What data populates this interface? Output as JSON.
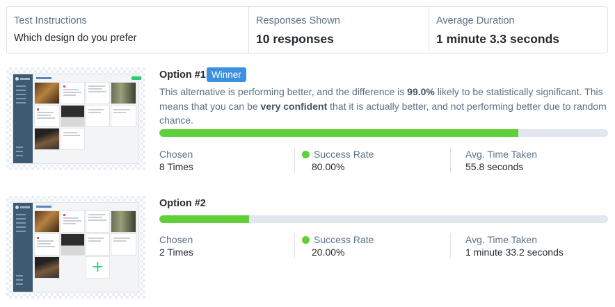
{
  "summary": {
    "test_instructions_label": "Test Instructions",
    "test_instructions_value": "Which design do you prefer",
    "responses_label": "Responses Shown",
    "responses_value": "10 responses",
    "duration_label": "Average Duration",
    "duration_value": "1 minute 3.3 seconds"
  },
  "options": [
    {
      "title": "Option #1",
      "badge": "Winner",
      "description_parts": {
        "p1": "This alternative is performing better, and the difference is ",
        "pct": "99.0%",
        "p2": " likely to be statistically significant. This means that you can be ",
        "conf": "very confident",
        "p3": " that it is actually better, and not performing better due to random chance."
      },
      "progress_fraction": 0.8,
      "chosen_label": "Chosen",
      "chosen_value": "8 Times",
      "success_label": "Success Rate",
      "success_value": "80.00%",
      "time_label": "Avg. Time Taken",
      "time_value": "55.8 seconds"
    },
    {
      "title": "Option #2",
      "progress_fraction": 0.2,
      "chosen_label": "Chosen",
      "chosen_value": "2 Times",
      "success_label": "Success Rate",
      "success_value": "20.00%",
      "time_label": "Avg. Time Taken",
      "time_value": "1 minute 33.2 seconds"
    }
  ],
  "colors": {
    "accent": "#3d8fe0",
    "success": "#5fcf3a",
    "label": "#5a7088",
    "sidebar": "#3d5a72"
  },
  "icons": [
    "success-dot-icon",
    "plus-icon"
  ]
}
